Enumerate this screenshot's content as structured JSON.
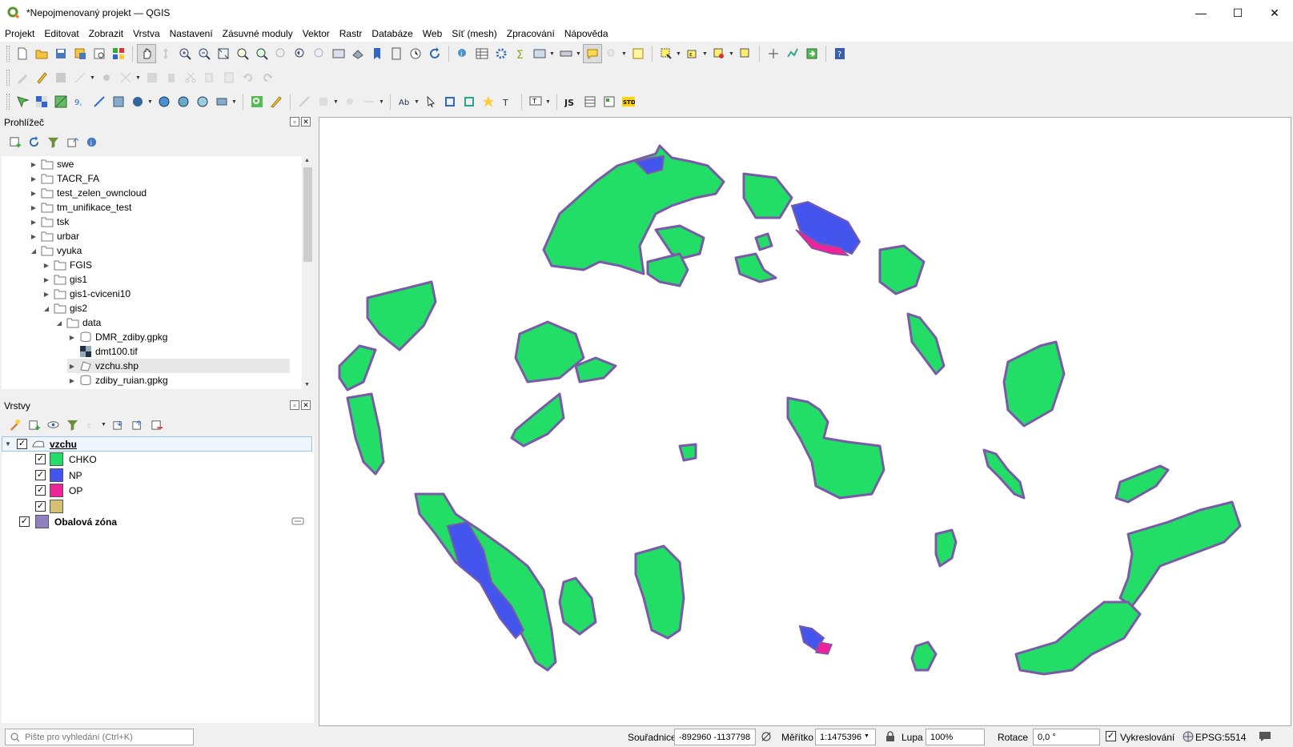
{
  "window": {
    "title": "*Nepojmenovaný projekt — QGIS",
    "minimize": "—",
    "maximize": "☐",
    "close": "✕"
  },
  "menu": [
    "Projekt",
    "Editovat",
    "Zobrazit",
    "Vrstva",
    "Nastavení",
    "Zásuvné moduly",
    "Vektor",
    "Rastr",
    "Databáze",
    "Web",
    "Síť (mesh)",
    "Zpracování",
    "Nápověda"
  ],
  "browser": {
    "title": "Prohlížeč",
    "items": [
      {
        "label": "swe",
        "depth": 0,
        "type": "folder",
        "state": "collapsed"
      },
      {
        "label": "TACR_FA",
        "depth": 0,
        "type": "folder",
        "state": "collapsed"
      },
      {
        "label": "test_zelen_owncloud",
        "depth": 0,
        "type": "folder",
        "state": "collapsed"
      },
      {
        "label": "tm_unifikace_test",
        "depth": 0,
        "type": "folder",
        "state": "collapsed"
      },
      {
        "label": "tsk",
        "depth": 0,
        "type": "folder",
        "state": "collapsed"
      },
      {
        "label": "urbar",
        "depth": 0,
        "type": "folder",
        "state": "collapsed"
      },
      {
        "label": "vyuka",
        "depth": 0,
        "type": "folder",
        "state": "expanded"
      },
      {
        "label": "FGIS",
        "depth": 1,
        "type": "folder",
        "state": "collapsed"
      },
      {
        "label": "gis1",
        "depth": 1,
        "type": "folder",
        "state": "collapsed"
      },
      {
        "label": "gis1-cviceni10",
        "depth": 1,
        "type": "folder",
        "state": "collapsed"
      },
      {
        "label": "gis2",
        "depth": 1,
        "type": "folder",
        "state": "expanded"
      },
      {
        "label": "data",
        "depth": 2,
        "type": "folder",
        "state": "expanded"
      },
      {
        "label": "DMR_zdiby.gpkg",
        "depth": 3,
        "type": "gpkg",
        "state": "collapsed"
      },
      {
        "label": "dmt100.tif",
        "depth": 3,
        "type": "raster",
        "state": "none"
      },
      {
        "label": "vzchu.shp",
        "depth": 3,
        "type": "vector",
        "state": "collapsed",
        "selected": true
      },
      {
        "label": "zdiby_ruian.gpkg",
        "depth": 3,
        "type": "gpkg",
        "state": "collapsed"
      }
    ]
  },
  "layers": {
    "title": "Vrstvy",
    "group": {
      "label": "vzchu",
      "checked": true
    },
    "categories": [
      {
        "label": "CHKO",
        "color": "#22dd66",
        "checked": true
      },
      {
        "label": "NP",
        "color": "#4455ee",
        "checked": true
      },
      {
        "label": "OP",
        "color": "#ee2299",
        "checked": true
      },
      {
        "label": "",
        "color": "#d4c070",
        "checked": true
      }
    ],
    "buffer": {
      "label": "Obalová zóna",
      "color": "#9080c0",
      "checked": true
    }
  },
  "map": {
    "chko_color": "#22dd66",
    "np_color": "#4455ee",
    "op_color": "#ee2299",
    "buffer_color": "#8060a8"
  },
  "status": {
    "search_placeholder": "Pište pro vyhledání (Ctrl+K)",
    "coord_label": "Souřadnice",
    "coord_value": "-892960 -1137798",
    "scale_label": "Měřítko",
    "scale_value": "1:1475396",
    "zoom_label": "Lupa",
    "zoom_value": "100%",
    "rotation_label": "Rotace",
    "rotation_value": "0,0 °",
    "render_label": "Vykreslování",
    "crs": "EPSG:5514"
  }
}
